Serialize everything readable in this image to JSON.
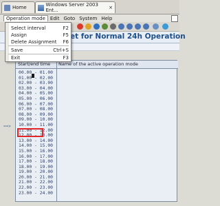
{
  "browser": {
    "tab1": "Home",
    "tab2": "Windows Server 2003 Ent...",
    "tab_close": "×"
  },
  "menubar": [
    "Operation mode",
    "Edit",
    "Goto",
    "System",
    "Help"
  ],
  "dropdown": [
    {
      "label": "Select interval",
      "key": "F2"
    },
    {
      "label": "Assign",
      "key": "F5"
    },
    {
      "label": "Delete Assignment",
      "key": "F6"
    },
    {
      "label": "Save",
      "key": "Ctrl+S"
    },
    {
      "label": "Exit",
      "key": "F3"
    }
  ],
  "screen": {
    "title": "et for Normal 24h Operation",
    "col_time": "Start/end time",
    "col_mode": "Name of the active operation mode",
    "marker": "==>"
  },
  "time_rows": [
    "00.00 - 01.00",
    "01.00 - 02.00",
    "02.00 - 03.00",
    "03.00 - 04.00",
    "04.00 - 05.00",
    "05.00 - 06.00",
    "06.00 - 07.00",
    "07.00 - 08.00",
    "08.00 - 09.00",
    "09.00 - 10.00",
    "10.00 - 11.00",
    "11.00 - 12.00",
    "12.00 - 13.00",
    "13.00 - 14.00",
    "14.00 - 15.00",
    "15.00 - 16.00",
    "16.00 - 17.00",
    "17.00 - 18.00",
    "18.00 - 19.00",
    "19.00 - 20.00",
    "20.00 - 21.00",
    "21.00 - 22.00",
    "22.00 - 23.00",
    "23.00 - 24.00"
  ],
  "highlighted_row": "15.00 - 16.00",
  "colors": {
    "title": "#1f4f8a",
    "highlight": "#e0262b"
  }
}
